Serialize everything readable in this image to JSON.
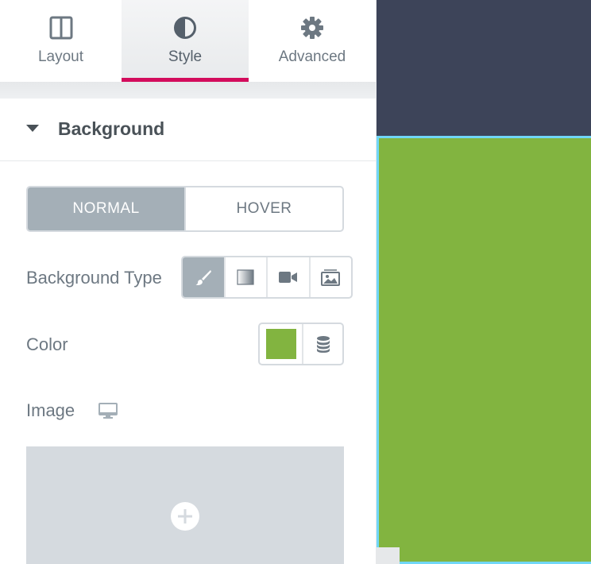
{
  "tabs": [
    {
      "label": "Layout",
      "icon": "columns-icon"
    },
    {
      "label": "Style",
      "icon": "half-circle-icon",
      "active": true
    },
    {
      "label": "Advanced",
      "icon": "gear-icon"
    }
  ],
  "section": {
    "title": "Background",
    "expanded": true
  },
  "state_toggle": {
    "options": [
      "NORMAL",
      "HOVER"
    ],
    "selected": "NORMAL"
  },
  "background_type": {
    "label": "Background Type",
    "options": [
      "paint-brush-icon",
      "gradient-icon",
      "video-icon",
      "slideshow-icon"
    ],
    "selected": "paint-brush-icon"
  },
  "color": {
    "label": "Color",
    "value": "#82b440",
    "dynamic_icon": "database-icon"
  },
  "image": {
    "label": "Image",
    "responsive_icon": "desktop-icon",
    "add_icon": "plus-circle-icon"
  },
  "colors": {
    "accent": "#d30c5c",
    "active_toggle": "#a4afb7",
    "canvas_top": "#3d4459",
    "canvas_section": "#82b440",
    "selection_outline": "#71d7f7"
  }
}
